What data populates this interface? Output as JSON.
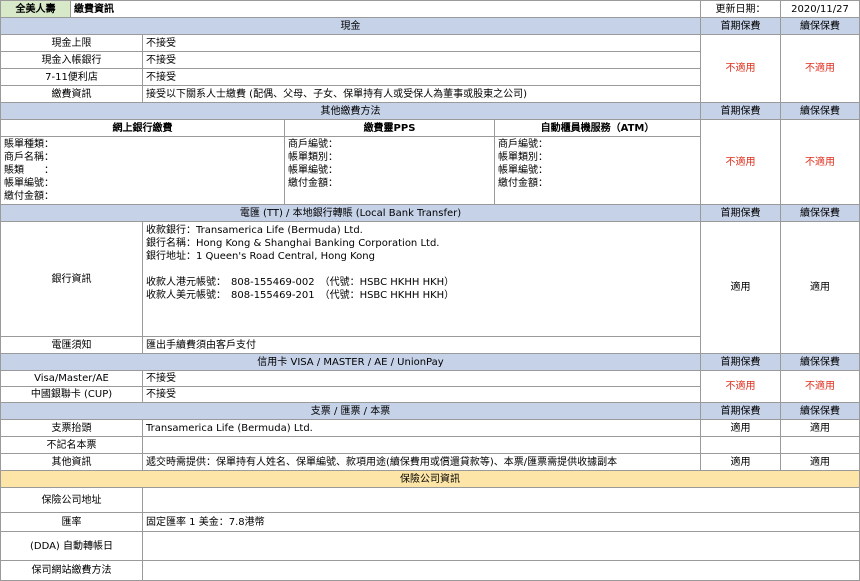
{
  "header": {
    "company": "全美人壽",
    "title": "繳費資訊",
    "update_label": "更新日期：",
    "update_date": "2020/11/27"
  },
  "columns": {
    "first": "首期保費",
    "renewal": "續保保費"
  },
  "cash": {
    "title": "現金",
    "rows": [
      {
        "label": "現金上限",
        "value": "不接受"
      },
      {
        "label": "現金入帳銀行",
        "value": "不接受"
      },
      {
        "label": "7-11便利店",
        "value": "不接受"
      },
      {
        "label": "繳費資訊",
        "value": "接受以下關系人士繳費 (配偶、父母、子女、保單持有人或受保人為董事或股東之公司)"
      }
    ],
    "first": "不適用",
    "renewal": "不適用"
  },
  "other": {
    "title": "其他繳費方法",
    "online_bank": {
      "title": "網上銀行繳費",
      "lines": [
        "賬單種類：",
        "商戶名稱：",
        "賬類　　：",
        "帳單編號：",
        "繳付金額："
      ]
    },
    "pps": {
      "title": "繳費靈PPS",
      "lines": [
        "商戶編號：",
        "帳單類別：",
        "帳單編號：",
        "繳付金額："
      ]
    },
    "atm": {
      "title": "自動櫃員機服務（ATM）",
      "lines": [
        "商戶編號：",
        "帳單類別：",
        "帳單編號：",
        "繳付金額："
      ]
    },
    "first": "不適用",
    "renewal": "不適用"
  },
  "tt": {
    "title": "電匯 (TT) / 本地銀行轉賬 (Local Bank Transfer)",
    "bank_label": "銀行資訊",
    "bank_lines": [
      "收款銀行：Transamerica Life (Bermuda) Ltd.",
      "銀行名稱：Hong Kong & Shanghai Banking Corporation Ltd.",
      "銀行地址：1 Queen's Road Central, Hong Kong",
      "",
      "收款人港元帳號：　808-155469-002　（代號：HSBC HKHH HKH）",
      "收款人美元帳號：　808-155469-201　（代號：HSBC HKHH HKH）"
    ],
    "notice_label": "電匯須知",
    "notice_value": "匯出手續費須由客戶支付",
    "first": "適用",
    "renewal": "適用"
  },
  "card": {
    "title": "信用卡 VISA / MASTER / AE / UnionPay",
    "rows": [
      {
        "label": "Visa/Master/AE",
        "value": "不接受"
      },
      {
        "label": "中國銀聯卡 (CUP)",
        "value": "不接受"
      }
    ],
    "first": "不適用",
    "renewal": "不適用"
  },
  "cheque": {
    "title": "支票 / 匯票 / 本票",
    "rows": [
      {
        "label": "支票抬頭",
        "value": "Transamerica Life (Bermuda) Ltd.",
        "first": "適用",
        "renewal": "適用"
      },
      {
        "label": "不記名本票",
        "value": "",
        "first": "",
        "renewal": ""
      },
      {
        "label": "其他資訊",
        "value": "遞交時需提供：保單持有人姓名、保單編號、款項用途(續保費用或償還貸款等)、本票/匯票需提供收據副本",
        "first": "適用",
        "renewal": "適用"
      }
    ]
  },
  "insurer": {
    "title": "保險公司資訊",
    "rows": [
      {
        "label": "保險公司地址",
        "value": ""
      },
      {
        "label": "匯率",
        "value": "固定匯率 1 美金：7.8港幣"
      },
      {
        "label": "(DDA)  自動轉帳日",
        "value": ""
      },
      {
        "label": "保司網站繳費方法",
        "value": ""
      }
    ]
  }
}
